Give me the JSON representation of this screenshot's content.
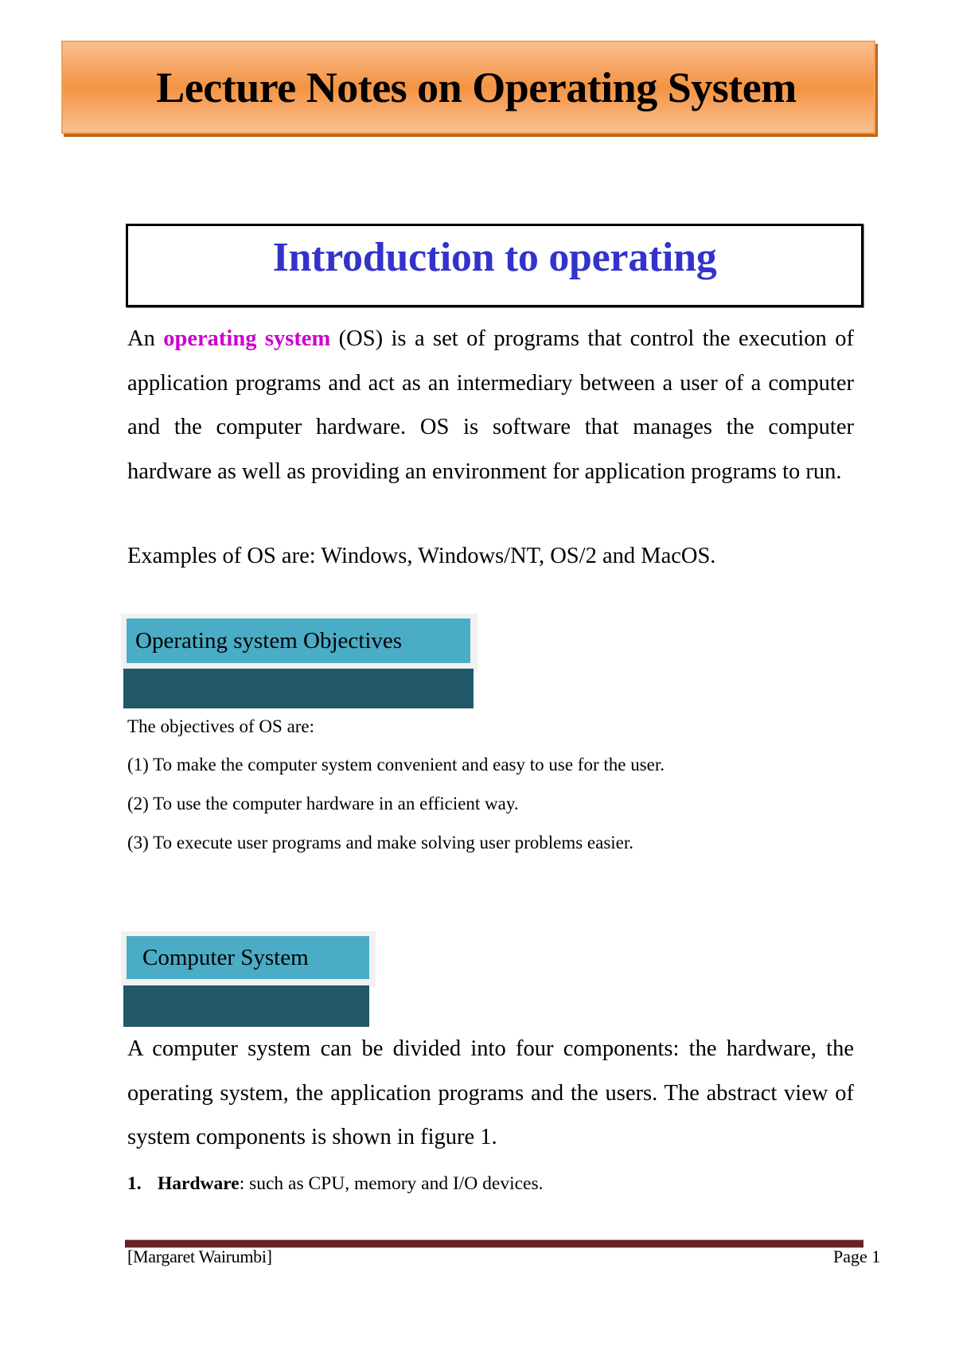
{
  "header": {
    "title": "Lecture Notes on Operating System"
  },
  "intro": {
    "heading": "Introduction to operating",
    "paragraph": {
      "prefix": "An ",
      "highlight": "operating system",
      "rest": " (OS) is a set of programs that control the execution of application programs and act as an intermediary between a user of a computer and the computer hardware. OS is software that manages the computer hardware as well as providing an environment for application programs to run."
    },
    "examples": "Examples of OS are: Windows, Windows/NT, OS/2 and MacOS."
  },
  "objectives": {
    "heading": "Operating system Objectives",
    "intro": "The objectives of OS are:",
    "items": [
      "(1) To make the computer system convenient and easy to use for the user.",
      "(2) To use the computer hardware in an efficient way.",
      "(3) To execute user programs and make solving user problems easier."
    ]
  },
  "computer_system": {
    "heading": "Computer System",
    "paragraph": "A computer system can be divided into four components: the hardware, the operating system, the application programs and the users. The abstract view of system components is shown in figure 1.",
    "list": [
      {
        "number": "1.",
        "term": "Hardware",
        "description": ": such as CPU, memory and I/O devices."
      }
    ]
  },
  "footer": {
    "author": "[Margaret Wairumbi]",
    "page": "Page 1"
  },
  "colors": {
    "banner_orange": "#f49442",
    "heading_blue": "#3333cc",
    "highlight_magenta": "#cc00cc",
    "section_blue": "#4bacc6",
    "section_dark": "#215968",
    "footer_bar": "#632523"
  }
}
